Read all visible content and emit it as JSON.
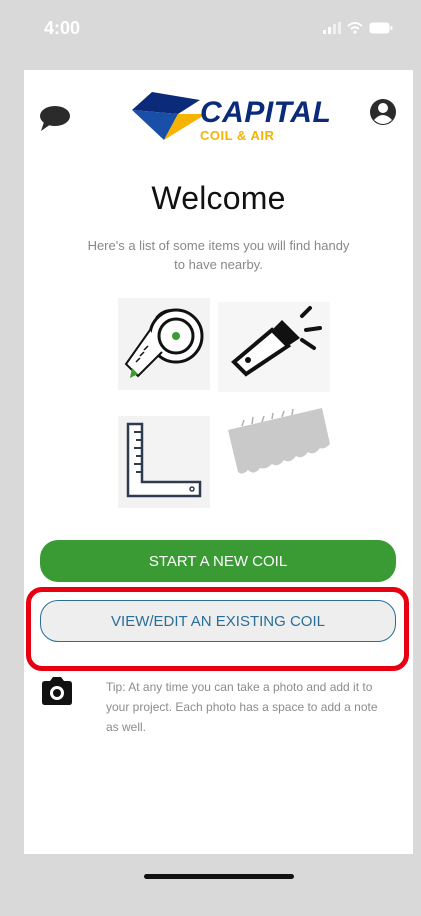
{
  "status_bar": {
    "time": "4:00"
  },
  "header": {
    "logo_main": "CAPITAL",
    "logo_sub": "COIL & AIR"
  },
  "main": {
    "title": "Welcome",
    "subtitle": "Here's a list of some items you will find handy to have nearby.",
    "items": [
      {
        "icon": "tape-measure-icon"
      },
      {
        "icon": "flashlight-icon"
      },
      {
        "icon": "carpenter-square-icon"
      },
      {
        "icon": "fin-comb-icon"
      }
    ],
    "start_button": "START A NEW COIL",
    "view_button": "VIEW/EDIT AN EXISTING COIL",
    "tip": "Tip: At any time you can take a photo and add it to your project. Each photo has a space to add a note as well."
  },
  "colors": {
    "accent_green": "#3a9b34",
    "accent_blue": "#2a6e96",
    "highlight_red": "#e60012",
    "logo_navy": "#0b2b7a",
    "logo_yellow": "#f6b300"
  }
}
